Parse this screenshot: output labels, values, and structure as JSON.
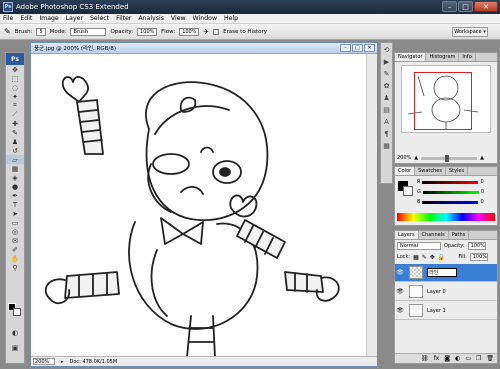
{
  "app": {
    "title": "Adobe Photoshop CS3 Extended",
    "icon": "Ps"
  },
  "window_controls": {
    "minimize": "–",
    "maximize": "□",
    "close": "✕"
  },
  "menu": [
    "File",
    "Edit",
    "Image",
    "Layer",
    "Select",
    "Filter",
    "Analysis",
    "View",
    "Window",
    "Help"
  ],
  "options": {
    "brush_label": "Brush:",
    "brush_size": "5",
    "mode_label": "Mode:",
    "mode_value": "Brush",
    "opacity_label": "Opacity:",
    "opacity_value": "100%",
    "flow_label": "Flow:",
    "flow_value": "100%",
    "erase_history_label": "Erase to History",
    "workspace_label": "Workspace ▾"
  },
  "toolbox": {
    "logo": "Ps"
  },
  "document": {
    "title": "풍군.jpg @ 200% (라인, RGB/8)",
    "zoom": "200%",
    "doc_info": "Doc: 478.0K/1.05M"
  },
  "navigator": {
    "tabs": [
      "Navigator",
      "Histogram",
      "Info"
    ],
    "zoom": "200%"
  },
  "color": {
    "tabs": [
      "Color",
      "Swatches",
      "Styles"
    ],
    "channels": [
      {
        "label": "R",
        "value": "0"
      },
      {
        "label": "G",
        "value": "0"
      },
      {
        "label": "B",
        "value": "0"
      }
    ],
    "accent": "#3a7fd6"
  },
  "layers": {
    "tabs": [
      "Layers",
      "Channels",
      "Paths"
    ],
    "blend_mode": "Normal",
    "opacity_label": "Opacity:",
    "opacity_value": "100%",
    "lock_label": "Lock:",
    "fill_label": "Fill:",
    "fill_value": "100%",
    "items": [
      {
        "name": "라인",
        "selected": true
      },
      {
        "name": "Layer 0",
        "selected": false
      },
      {
        "name": "Layer 1",
        "selected": false
      }
    ]
  }
}
